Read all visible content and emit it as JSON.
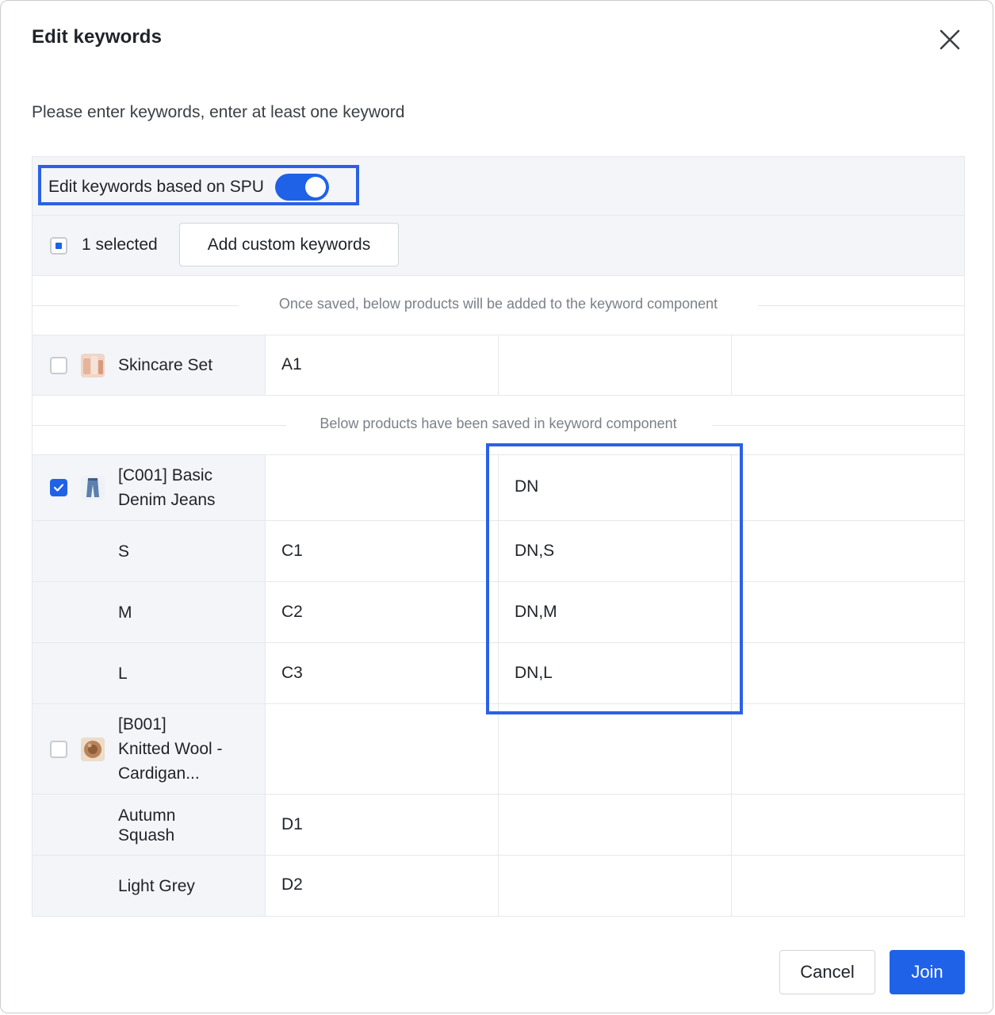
{
  "dialog": {
    "title": "Edit keywords",
    "instruction": "Please enter keywords, enter at least one keyword"
  },
  "toolbar": {
    "spu_toggle_label": "Edit keywords based on SPU",
    "spu_toggle_on": true,
    "selected_count": "1 selected",
    "add_custom_label": "Add custom keywords"
  },
  "sections": {
    "unsaved_divider": "Once saved, below products will be added to the keyword component",
    "saved_divider": "Below products have been saved in keyword component"
  },
  "products": {
    "skincare": {
      "name": "Skincare Set",
      "col2": "A1",
      "col3": "",
      "col4": "",
      "checked": false
    },
    "jeans": {
      "name": "[C001] Basic Denim Jeans",
      "name_line1": "[C001] Basic",
      "name_line2": "Denim Jeans",
      "col2": "",
      "col3": "DN",
      "col4": "",
      "checked": true,
      "variants": [
        {
          "name": "S",
          "col2": "C1",
          "col3": "DN,S"
        },
        {
          "name": "M",
          "col2": "C2",
          "col3": "DN,M"
        },
        {
          "name": "L",
          "col2": "C3",
          "col3": "DN,L"
        }
      ]
    },
    "cardigan": {
      "name_line1": "[B001]",
      "name_line2": "Knitted Wool -",
      "name_line3": "Cardigan...",
      "checked": false,
      "variants": [
        {
          "name_line1": "Autumn",
          "name_line2": "Squash",
          "col2": "D1",
          "col3": ""
        },
        {
          "name": "Light Grey",
          "col2": "D2",
          "col3": ""
        }
      ]
    }
  },
  "footer": {
    "cancel_label": "Cancel",
    "join_label": "Join"
  },
  "colors": {
    "primary": "#1f62e8",
    "highlight_box": "#2a61e6",
    "row_label_bg": "#f3f5f8"
  }
}
